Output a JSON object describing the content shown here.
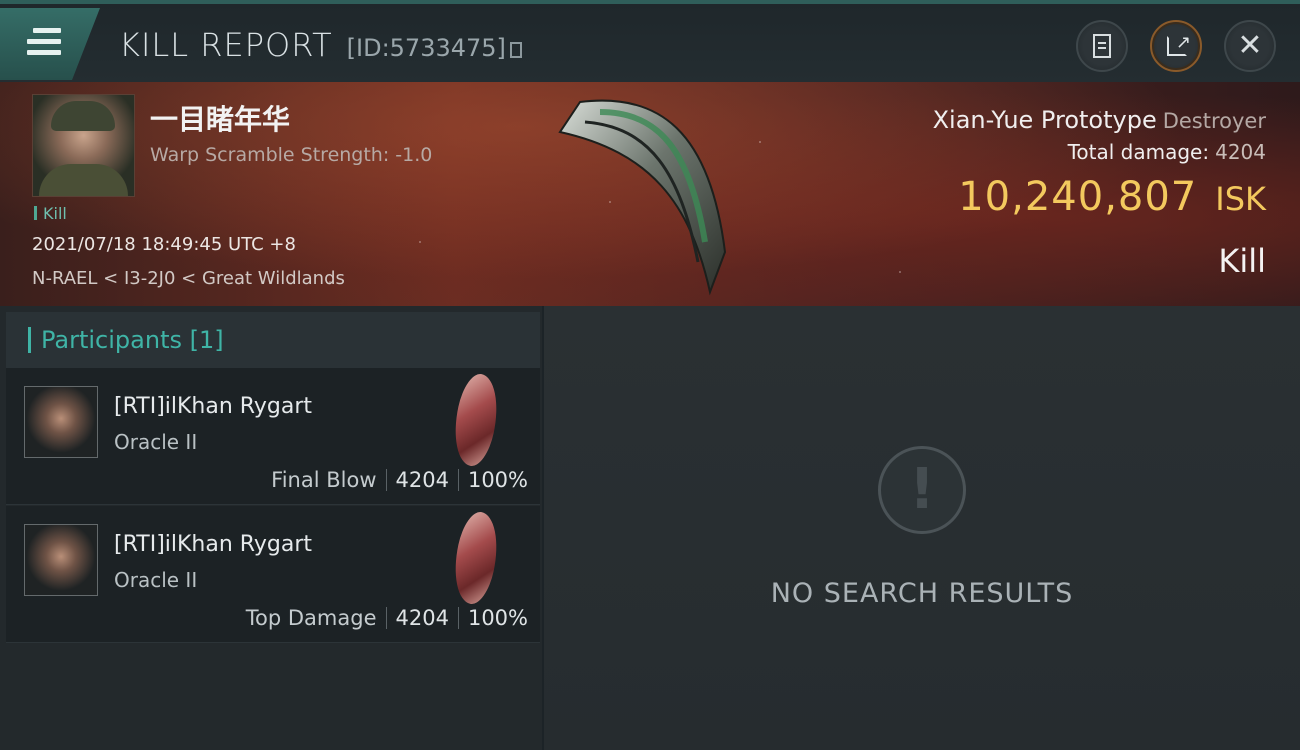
{
  "header": {
    "title": "KILL REPORT",
    "report_id": "[ID:5733475]",
    "icons": [
      "menu-icon",
      "copy-icon",
      "document-icon",
      "share-icon",
      "close-icon"
    ]
  },
  "victim": {
    "pilot_name": "一目睹年华",
    "scramble_text": "Warp Scramble Strength: -1.0",
    "tag": "Kill",
    "datetime": "2021/07/18 18:49:45 UTC +8",
    "location": "N-RAEL < I3-2J0 < Great Wildlands",
    "ship_name": "Xian-Yue Prototype",
    "ship_class": "Destroyer",
    "total_damage_label": "Total damage:",
    "total_damage": "4204",
    "isk_value": "10,240,807",
    "isk_unit": "ISK",
    "status": "Kill"
  },
  "participants": {
    "title": "Participants [1]",
    "rows": [
      {
        "name": "[RTI]ilKhan Rygart",
        "ship": "Oracle II",
        "label": "Final Blow",
        "damage": "4204",
        "percent": "100%"
      },
      {
        "name": "[RTI]ilKhan Rygart",
        "ship": "Oracle II",
        "label": "Top Damage",
        "damage": "4204",
        "percent": "100%"
      }
    ]
  },
  "results": {
    "message": "NO SEARCH RESULTS"
  },
  "colors": {
    "accent_teal": "#3fb4a6",
    "isk_gold": "#f3c95e"
  }
}
